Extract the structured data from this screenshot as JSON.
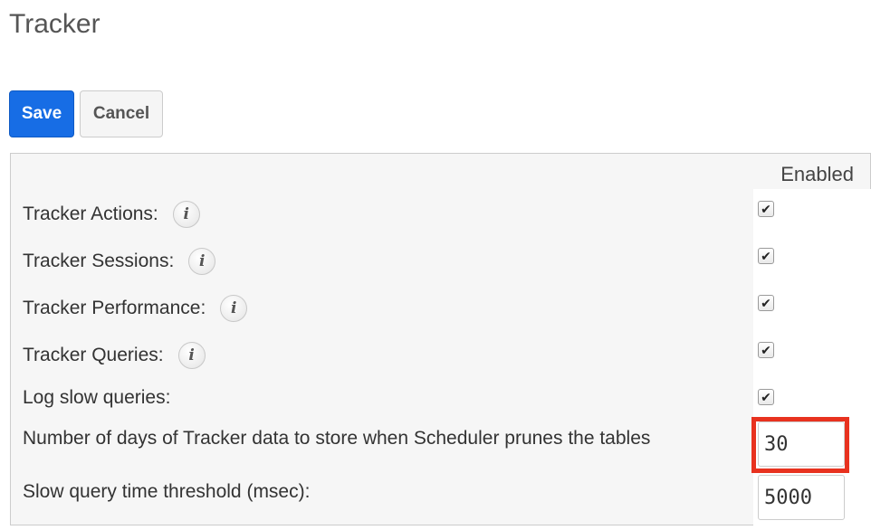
{
  "page": {
    "title": "Tracker"
  },
  "toolbar": {
    "save_label": "Save",
    "cancel_label": "Cancel"
  },
  "table": {
    "column_header": "Enabled",
    "rows": [
      {
        "label": "Tracker Actions:",
        "info": true,
        "checked": true
      },
      {
        "label": "Tracker Sessions:",
        "info": true,
        "checked": true
      },
      {
        "label": "Tracker Performance:",
        "info": true,
        "checked": true
      },
      {
        "label": "Tracker Queries:",
        "info": true,
        "checked": true
      },
      {
        "label": "Log slow queries:",
        "info": false,
        "checked": true
      }
    ],
    "days_to_store": {
      "label": "Number of days of Tracker data to store when Scheduler prunes the tables",
      "value": "30"
    },
    "slow_query_threshold": {
      "label": "Slow query time threshold (msec):",
      "value": "5000"
    }
  },
  "icons": {
    "info": "info-icon",
    "check": "checkmark-icon"
  },
  "colors": {
    "save_button": "#176de5",
    "highlight": "#e8321f"
  }
}
